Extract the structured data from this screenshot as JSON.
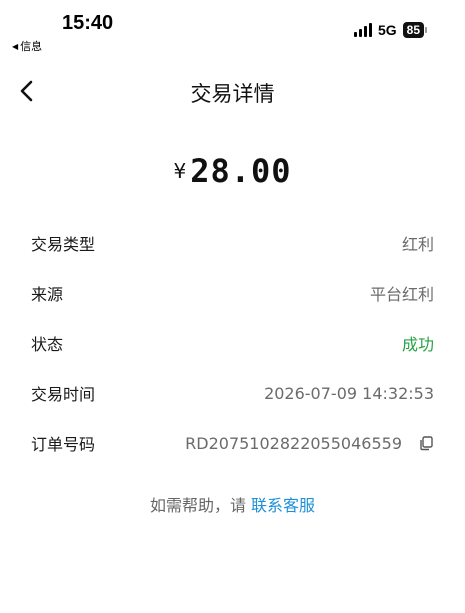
{
  "status_bar": {
    "time": "15:40",
    "back_app": "信息",
    "network": "5G",
    "battery": "85"
  },
  "nav": {
    "title": "交易详情"
  },
  "amount": {
    "currency": "¥",
    "value": "28.00"
  },
  "details": [
    {
      "label": "交易类型",
      "value": "红利"
    },
    {
      "label": "来源",
      "value": "平台红利"
    },
    {
      "label": "状态",
      "value": "成功"
    },
    {
      "label": "交易时间",
      "value": "2026-07-09 14:32:53"
    },
    {
      "label": "订单号码",
      "value": "RD20751028220550465​59"
    }
  ],
  "help": {
    "prefix": "如需帮助，请",
    "link": "联系客服"
  },
  "colors": {
    "success": "#27a245",
    "link": "#1e8fd8"
  }
}
